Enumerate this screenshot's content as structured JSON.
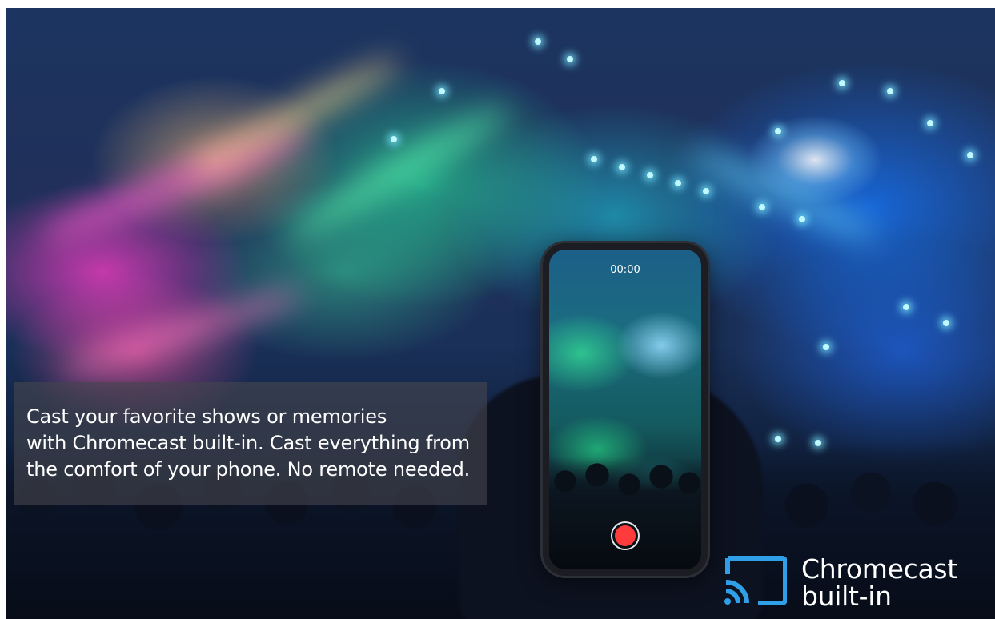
{
  "caption": {
    "lines": [
      "Cast your favorite shows or memories",
      "with Chromecast built-in. Cast everything from",
      "the comfort of your phone. No remote needed."
    ]
  },
  "phone": {
    "timer": "00:00",
    "record_color": "#ff3b3b"
  },
  "brand": {
    "line1": "Chromecast",
    "line2": "built-in",
    "icon": "cast-icon",
    "icon_color": "#2f9fe8"
  }
}
